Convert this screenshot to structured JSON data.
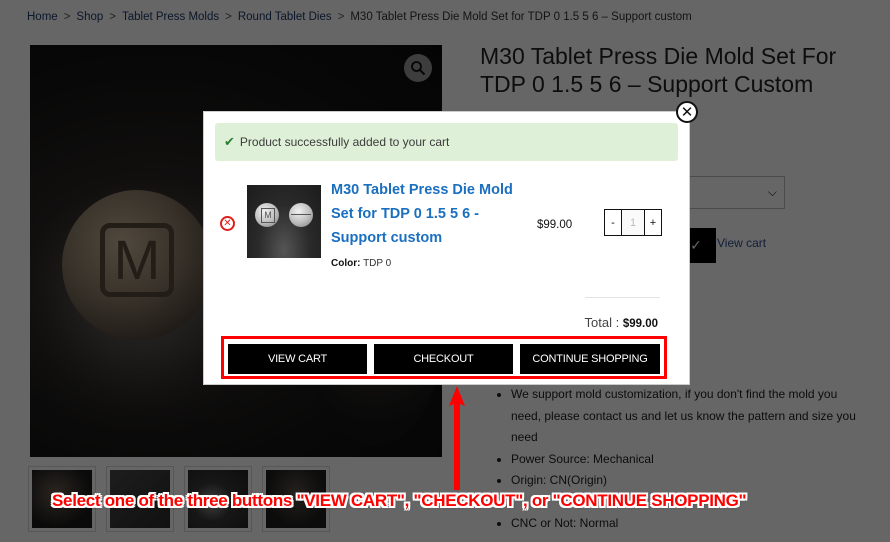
{
  "breadcrumb": {
    "items": [
      "Home",
      "Shop",
      "Tablet Press Molds",
      "Round Tablet Dies"
    ],
    "current": "M30 Tablet Press Die Mold Set for TDP 0 1.5 5 6 – Support custom",
    "separator": ">"
  },
  "product": {
    "title": "M30 Tablet Press Die Mold Set For TDP 0 1.5 5 6 – Support Custom",
    "image_stamp_letter": "M",
    "zoom_icon": "search-icon",
    "variation_select_value": "",
    "added_button_icon": "check-icon",
    "view_cart_link": "View cart",
    "features": [
      "We support mold customization, if you don't find the mold you need, please contact us and let us know the pattern and size you need",
      "Power Source: Mechanical",
      "Origin: CN(Origin)",
      "",
      "CNC or Not: Normal"
    ],
    "thumbnail_count": 4
  },
  "modal": {
    "close_icon": "close-icon",
    "notice": {
      "icon": "check-icon",
      "text": "Product successfully added to your cart"
    },
    "item": {
      "remove_icon": "remove-icon",
      "name": "M30 Tablet Press Die Mold Set for TDP 0 1.5 5 6 - Support custom",
      "attribute_label": "Color:",
      "attribute_value": "TDP 0",
      "price": "$99.00",
      "quantity": "1",
      "qty_minus": "-",
      "qty_plus": "+"
    },
    "total_label": "Total :",
    "total_value": "$99.00",
    "buttons": {
      "view_cart": "VIEW CART",
      "checkout": "CHECKOUT",
      "continue_shopping": "CONTINUE SHOPPING"
    }
  },
  "annotation": {
    "text": "Select one of the three buttons \"VIEW CART\", \"CHECKOUT\", or \"CONTINUE SHOPPING\"",
    "color": "#ff0000"
  },
  "colors": {
    "link_blue": "#1a6fbf",
    "notice_bg": "#dff0d8",
    "notice_check": "#2e7d32",
    "remove_red": "#e0201c",
    "button_bg": "#000000",
    "overlay": "rgba(0,0,0,0.6)"
  }
}
